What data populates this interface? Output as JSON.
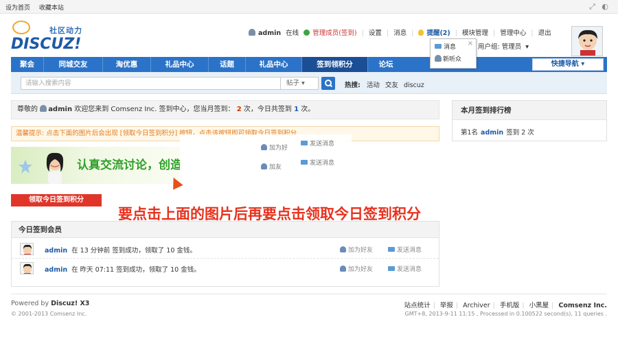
{
  "topbar": {
    "set_home": "设为首页",
    "bookmark": "收藏本站"
  },
  "logo": {
    "tagline": "社区动力",
    "wordmark": "DISCUZ!"
  },
  "user_nav": {
    "username": "admin",
    "status": "在线",
    "group": "管理成员(签到)",
    "settings": "设置",
    "messages": "消息",
    "reminders": "提醒(2)",
    "module_manage": "模块管理",
    "admin_center": "管理中心",
    "logout": "退出",
    "user_group": "用户组: 管理员"
  },
  "notify_popup": {
    "messages": "消息",
    "new_listener": "新听众"
  },
  "nav": {
    "items": [
      "聚会",
      "同城交友",
      "淘优惠",
      "礼品中心",
      "话题",
      "礼品中心",
      "签到领积分",
      "论坛"
    ],
    "active_index": 6,
    "quick_nav": "快捷导航"
  },
  "search": {
    "placeholder": "请输入搜索内容",
    "scope": "帖子",
    "hot_label": "热搜:",
    "hot_terms": [
      "活动",
      "交友",
      "discuz"
    ]
  },
  "welcome": {
    "prefix": "尊敬的",
    "username": "admin",
    "text1": "欢迎您来到 Comsenz Inc. 签到中心，您当月签到：",
    "month_count": "2",
    "text2": "次，今日共签到",
    "today_count": "1",
    "text3": "次。"
  },
  "tip": {
    "text": "温馨提示: 点击下面的图片后会出现 [领取今日签到积分] 按钮，点击该按钮即可领取今日签到积分"
  },
  "banner": {
    "text": "认真交流讨论，创造"
  },
  "ghost_menu": {
    "add_friend_1": "加为好",
    "send_msg_1": "发送消息",
    "add_friend_2": "加友",
    "send_msg_2": "发送消息"
  },
  "sign_button": "领取今日签到积分",
  "instruction": "要点击上面的图片后再要点击领取今日签到积分",
  "members": {
    "title": "今日签到会员",
    "rows": [
      {
        "name": "admin",
        "detail": "在 13 分钟前 签到成功，领取了 10 金钱。",
        "add_friend": "加为好友",
        "send_msg": "发送消息"
      },
      {
        "name": "admin",
        "detail": "在 昨天 07:11 签到成功，领取了 10 金钱。",
        "add_friend": "加为好友",
        "send_msg": "发送消息"
      }
    ]
  },
  "rank": {
    "title": "本月签到排行榜",
    "rank_label": "第1名",
    "name": "admin",
    "signed": "签到 2 次"
  },
  "footer": {
    "powered_prefix": "Powered by",
    "powered_brand": "Discuz! X3",
    "copyright": "© 2001-2013 Comsenz Inc.",
    "links": [
      "站点统计",
      "举报",
      "Archiver",
      "手机版",
      "小黑屋"
    ],
    "company": "Comsenz Inc.",
    "gmt": "GMT+8, 2013-9-11 11:15 , Processed in 0.100522 second(s), 11 queries ."
  },
  "colors": {
    "nav_blue": "#2b73c8",
    "accent_red": "#e8321e",
    "link_blue": "#1d5aa6"
  }
}
